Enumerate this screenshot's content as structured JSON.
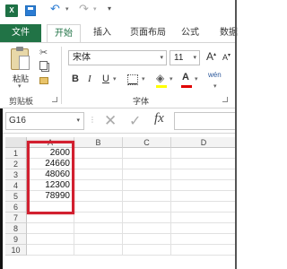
{
  "app": {
    "icon_label": "X"
  },
  "quick_access": {
    "undo_icon": "undo-icon",
    "redo_icon": "redo-icon",
    "save_icon": "save-icon"
  },
  "tabs": {
    "file": "文件",
    "home": "开始",
    "insert": "插入",
    "layout": "页面布局",
    "formula": "公式",
    "data": "数据"
  },
  "ribbon": {
    "clipboard": {
      "paste_label": "粘贴",
      "group_label": "剪贴板"
    },
    "font": {
      "font_name": "宋体",
      "font_size": "11",
      "bold": "B",
      "italic": "I",
      "underline": "U",
      "group_label": "字体",
      "phonetic": "wén",
      "font_color_glyph": "A",
      "fill_color": "#ffff00",
      "font_color": "#e00000"
    }
  },
  "formula_bar": {
    "name_box": "G16",
    "cancel_glyph": "✕",
    "enter_glyph": "✓",
    "fx_label": "fx",
    "formula": ""
  },
  "sheet": {
    "columns": [
      "A",
      "B",
      "C",
      "D"
    ],
    "rows": [
      "1",
      "2",
      "3",
      "4",
      "5",
      "6",
      "7",
      "8",
      "9",
      "10"
    ],
    "column_a_values": [
      "2600",
      "24660",
      "48060",
      "12300",
      "78990"
    ],
    "highlight_color": "#d21f2f"
  }
}
